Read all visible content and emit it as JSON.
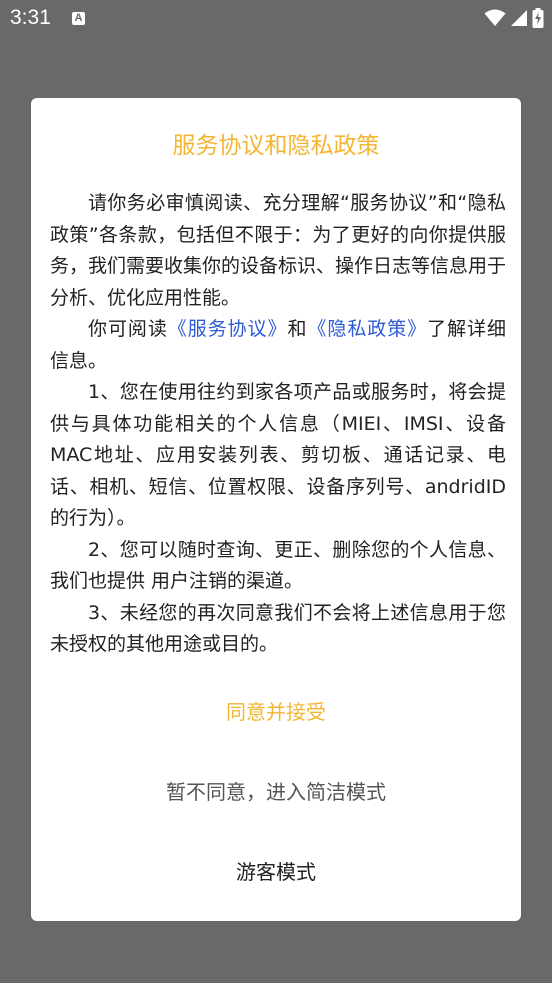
{
  "status_bar": {
    "time": "3:31",
    "notification_icon": "a-text-icon",
    "wifi_icon": "wifi-icon",
    "signal_icon": "cell-signal-icon",
    "battery_icon": "battery-charging-icon"
  },
  "dialog": {
    "title": "服务协议和隐私政策",
    "paragraph1": "请你务必审慎阅读、充分理解“服务协议”和“隐私政策”各条款，包括但不限于：为了更好的向你提供服务，我们需要收集你的设备标识、操作日志等信息用于分析、优化应用性能。",
    "paragraph2": {
      "prefix": "你可阅读",
      "link1": "《服务协议》",
      "middle": "和",
      "link2": "《隐私政策》",
      "suffix": "了解详细信息。"
    },
    "paragraph3": "1、您在使用往约到家各项产品或服务时，将会提供与具体功能相关的个人信息（MIEI、IMSI、设备MAC地址、应用安装列表、剪切板、通话记录、电话、相机、短信、位置权限、设备序列号、andridID的行为）。",
    "paragraph4": "2、您可以随时查询、更正、删除您的个人信息、我们也提供 用户注销的渠道。",
    "paragraph5": "3、未经您的再次同意我们不会将上述信息用于您未授权的其他用途或目的。",
    "agree_button": "同意并接受",
    "disagree_button": "暂不同意，进入简洁模式",
    "guest_button": "游客模式"
  },
  "colors": {
    "overlay": "#696969",
    "accent": "#f5b533",
    "link": "#2d5bd6"
  }
}
